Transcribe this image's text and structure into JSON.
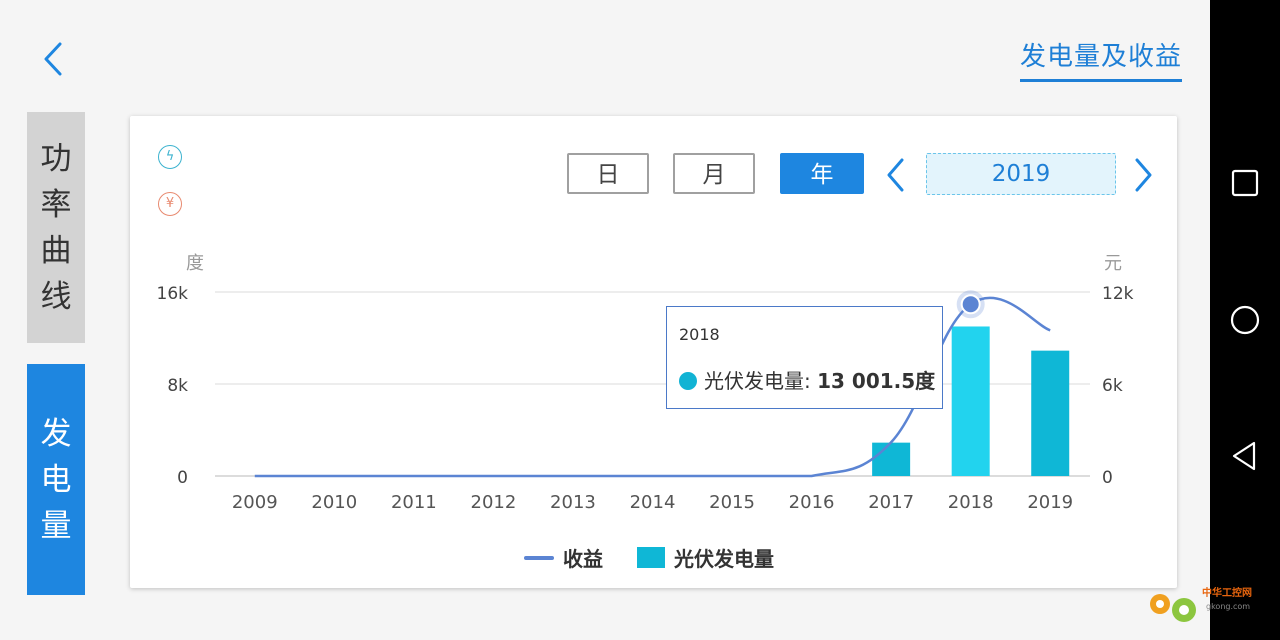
{
  "header": {
    "title": "发电量及收益"
  },
  "side_tabs": [
    {
      "label": [
        "功",
        "率",
        "曲",
        "线"
      ],
      "active": false
    },
    {
      "label": [
        "发",
        "电",
        "量"
      ],
      "active": true
    }
  ],
  "icons": {
    "bolt": "ϟ",
    "yen": "¥"
  },
  "period": {
    "day": "日",
    "month": "月",
    "year": "年",
    "selected": "年",
    "current_year": "2019"
  },
  "chart_data": {
    "type": "bar",
    "categories": [
      "2009",
      "2010",
      "2011",
      "2012",
      "2013",
      "2014",
      "2015",
      "2016",
      "2017",
      "2018",
      "2019"
    ],
    "left_axis": {
      "unit": "度",
      "ticks": [
        "0",
        "8k",
        "16k"
      ],
      "ylim": [
        0,
        16000
      ]
    },
    "right_axis": {
      "unit": "元",
      "ticks": [
        "0",
        "6k",
        "12k"
      ],
      "ylim": [
        0,
        12000
      ]
    },
    "series": [
      {
        "name": "光伏发电量",
        "type": "bar",
        "axis": "left",
        "values": [
          0,
          0,
          0,
          0,
          0,
          0,
          0,
          0,
          2900,
          13001.5,
          10900
        ]
      },
      {
        "name": "收益",
        "type": "line",
        "axis": "right",
        "values": [
          0,
          0,
          0,
          0,
          0,
          0,
          0,
          0,
          2200,
          11200,
          9500
        ]
      }
    ],
    "highlight_index": 9,
    "grid": true,
    "legend_position": "bottom"
  },
  "tooltip": {
    "year": "2018",
    "series": "光伏发电量",
    "value": "13 001.5",
    "unit": "度"
  },
  "legend": {
    "line_label": "收益",
    "bar_label": "光伏发电量"
  },
  "colors": {
    "accent": "#1e86e0",
    "bar": "#0fb7d6",
    "bar_highlight": "#22d3ee",
    "line": "#5b84d3"
  },
  "watermark": {
    "text": "中华工控网",
    "site": "gkong.com"
  }
}
